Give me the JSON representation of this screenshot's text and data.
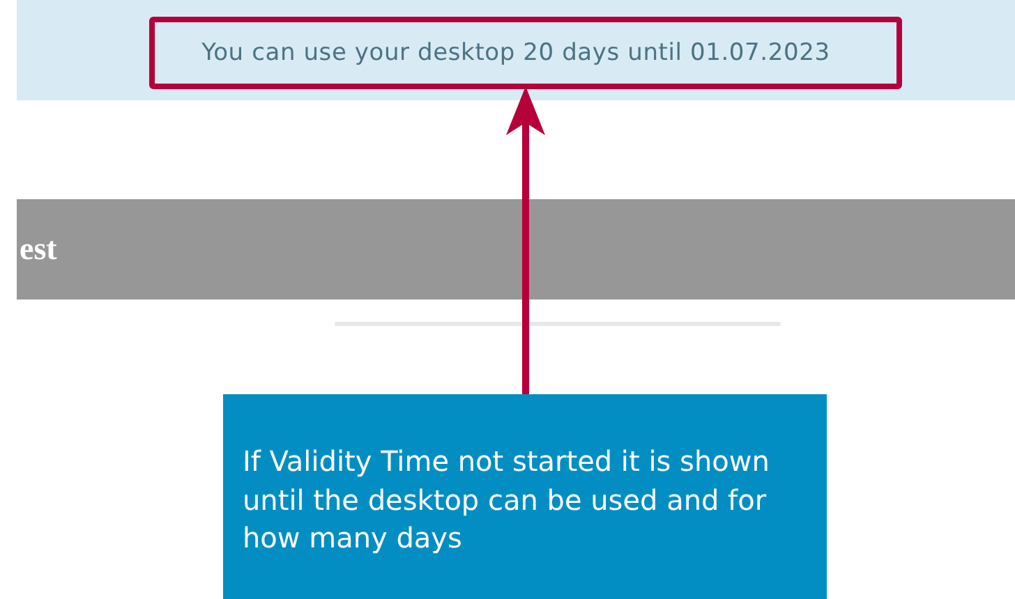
{
  "notice_banner": {
    "text": "You can use your desktop 20 days until 01.07.2023"
  },
  "section_header": {
    "title": "est"
  },
  "annotation": {
    "callout": "If Validity Time not started it is shown until the desktop can be used and for how many days"
  }
}
